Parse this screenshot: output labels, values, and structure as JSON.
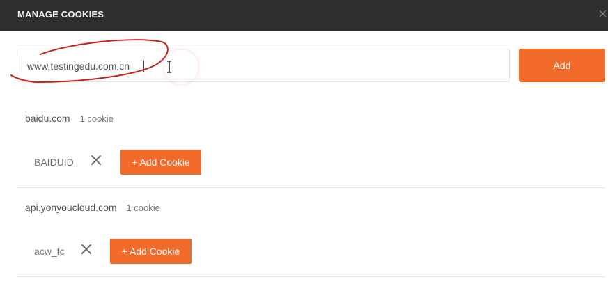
{
  "modal": {
    "title": "MANAGE COOKIES",
    "close_symbol": "×"
  },
  "domain_input": {
    "value": "www.testingedu.com.cn",
    "placeholder": ""
  },
  "add_button": {
    "label": "Add"
  },
  "domains": [
    {
      "name": "baidu.com",
      "count_label": "1 cookie",
      "cookies": [
        {
          "name": "BAIDUID"
        }
      ],
      "add_cookie_label": "+ Add Cookie"
    },
    {
      "name": "api.yonyoucloud.com",
      "count_label": "1 cookie",
      "cookies": [
        {
          "name": "acw_tc"
        }
      ],
      "add_cookie_label": "+ Add Cookie"
    }
  ],
  "colors": {
    "header_bg": "#2f2f2f",
    "accent": "#f26b2b",
    "annotation": "#c8201e"
  },
  "icons": {
    "close": "close-icon",
    "remove_cookie": "x-icon",
    "cursor": "text-cursor-icon"
  }
}
